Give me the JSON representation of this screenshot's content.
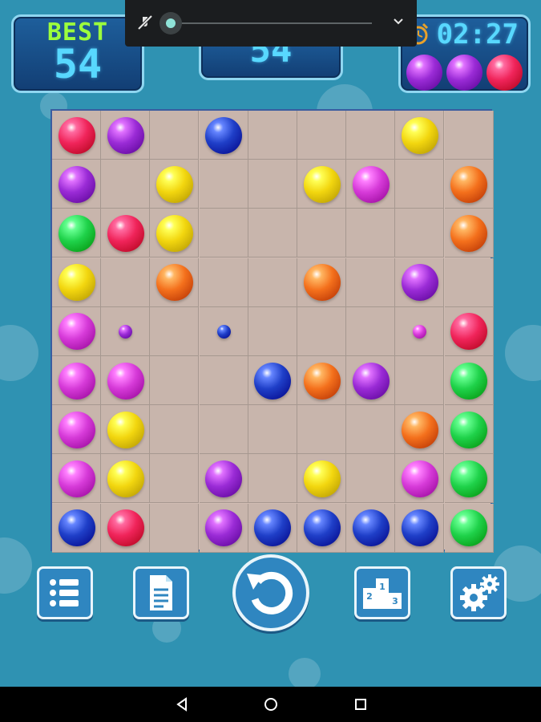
{
  "header": {
    "best_label": "BEST",
    "best_value": "54",
    "score_value": "54",
    "timer": "02:27",
    "next_balls": [
      "purple",
      "purple",
      "red"
    ]
  },
  "media_bar": {
    "volume_level": 0.0,
    "icons": [
      "mute-icon",
      "chevron-down-icon"
    ]
  },
  "board": {
    "rows": 9,
    "cols": 9,
    "legend": "R=red, P=purple, B=blue, Y=yellow, O=orange, M=magenta, G=green, lowercase=small upcoming ball, .=empty",
    "grid": [
      "RP.B...Y.",
      "P.Y..YM.O",
      "GRY.....O",
      "Y.O..O.P.",
      "Mp.b...mR",
      "MM..BOP.G",
      "MY.....OG",
      "MY.P.Y.MG",
      "BR.PBBBBG"
    ]
  },
  "colors": {
    "R": "#f0245a",
    "P": "#9a2bd6",
    "B": "#1f3fc8",
    "Y": "#f2d60f",
    "O": "#f4701c",
    "M": "#d63ad8",
    "G": "#1fd24a"
  },
  "toolbar": {
    "buttons": [
      "list-icon",
      "document-icon",
      "undo-icon",
      "podium-icon",
      "gears-icon"
    ]
  },
  "system_nav": {
    "buttons": [
      "back-icon",
      "home-icon",
      "recents-icon"
    ]
  }
}
